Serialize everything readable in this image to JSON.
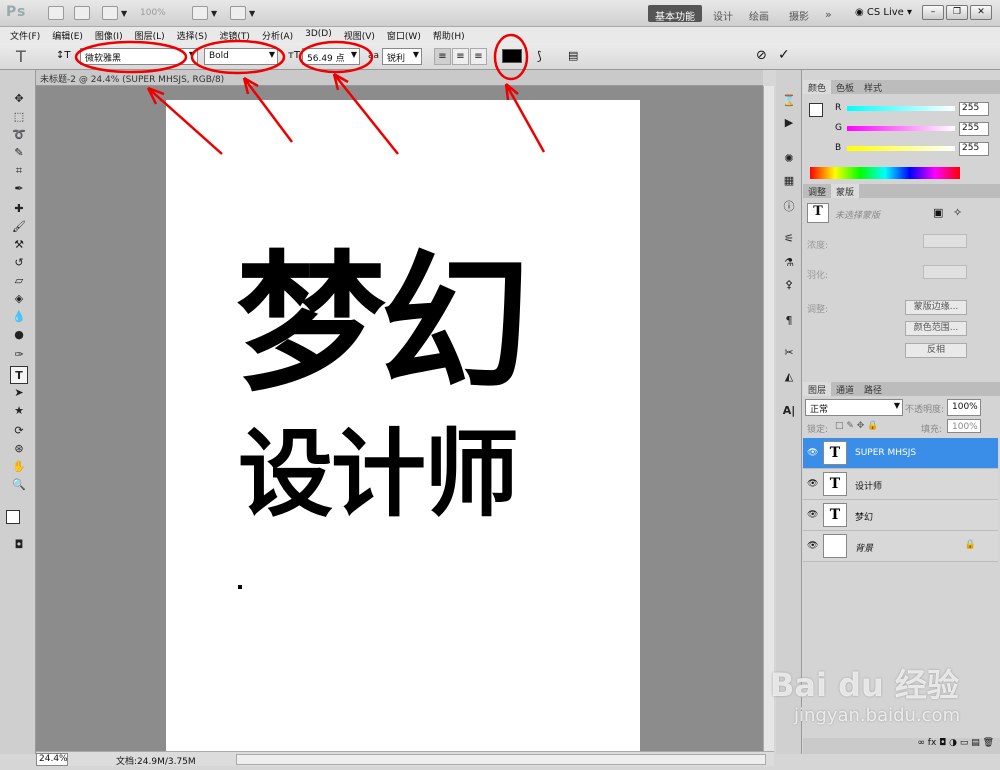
{
  "app": {
    "logo": "Ps",
    "zoom": "100%"
  },
  "workspaces": {
    "basic": "基本功能",
    "design": "设计",
    "paint": "绘画",
    "photo": "摄影",
    "more": "»",
    "cslive": "CS Live"
  },
  "menu": [
    "文件(F)",
    "编辑(E)",
    "图像(I)",
    "图层(L)",
    "选择(S)",
    "滤镜(T)",
    "分析(A)",
    "3D(D)",
    "视图(V)",
    "窗口(W)",
    "帮助(H)"
  ],
  "options": {
    "tool_glyph": "T",
    "font_family": "微软雅黑",
    "font_style": "Bold",
    "font_size": "56.49 点",
    "aa_label": "aa",
    "antialias": "锐利",
    "text_color": "#000000",
    "cancel": "⊘",
    "commit": "✓"
  },
  "document": {
    "tab_title": "未标题-2 @ 24.4% (SUPER MHSJS, RGB/8)",
    "line1": "梦幻",
    "line2": "设计师"
  },
  "status": {
    "zoom": "24.4%",
    "doc_size": "文档:24.9M/3.75M"
  },
  "color_panel": {
    "tabs": [
      "颜色",
      "色板",
      "样式"
    ],
    "r_label": "R",
    "g_label": "G",
    "b_label": "B",
    "r": "255",
    "g": "255",
    "b": "255"
  },
  "adjust_panel": {
    "tabs": [
      "调整",
      "蒙版"
    ],
    "no_mask": "未选择蒙版",
    "density": "浓度:",
    "feather": "羽化:",
    "refine": "调整:",
    "btn_edge": "蒙版边缘...",
    "btn_range": "颜色范围...",
    "btn_invert": "反相"
  },
  "layers_panel": {
    "tabs": [
      "图层",
      "通道",
      "路径"
    ],
    "blend": "正常",
    "opacity_label": "不透明度:",
    "opacity": "100%",
    "lock_label": "锁定:",
    "fill_label": "填充:",
    "fill": "100%",
    "layers": [
      {
        "name": "SUPER MHSJS",
        "type": "T",
        "selected": true
      },
      {
        "name": "设计师",
        "type": "T",
        "selected": false
      },
      {
        "name": "梦幻",
        "type": "T",
        "selected": false
      },
      {
        "name": "背景",
        "type": "",
        "selected": false,
        "locked": true
      }
    ]
  },
  "watermark": {
    "brand": "Bai du 经验",
    "url": "jingyan.baidu.com"
  }
}
